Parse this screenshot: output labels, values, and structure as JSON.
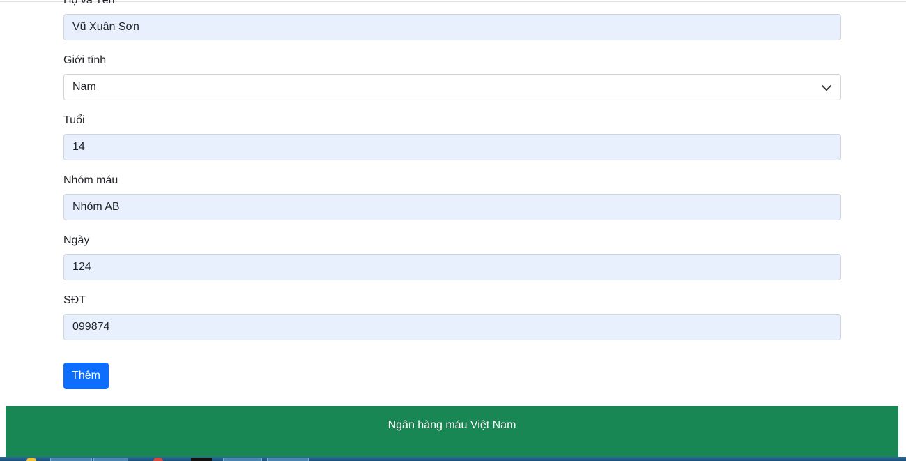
{
  "form": {
    "fullname": {
      "label": "Họ và Tên",
      "value": "Vũ Xuân Sơn"
    },
    "gender": {
      "label": "Giới tính",
      "value": "Nam"
    },
    "age": {
      "label": "Tuổi",
      "value": "14"
    },
    "blood_group": {
      "label": "Nhóm máu",
      "value": "Nhóm AB"
    },
    "date": {
      "label": "Ngày",
      "value": "124"
    },
    "phone": {
      "label": "SĐT",
      "value": "099874"
    },
    "submit_label": "Thêm"
  },
  "footer": {
    "text": "Ngân hàng máu Việt Nam"
  },
  "colors": {
    "primary_button": "#0d6efd",
    "footer_bg": "#198754",
    "autofill_bg": "#e8f0fe"
  },
  "icons": {
    "select_chevron": "chevron-down-icon"
  }
}
